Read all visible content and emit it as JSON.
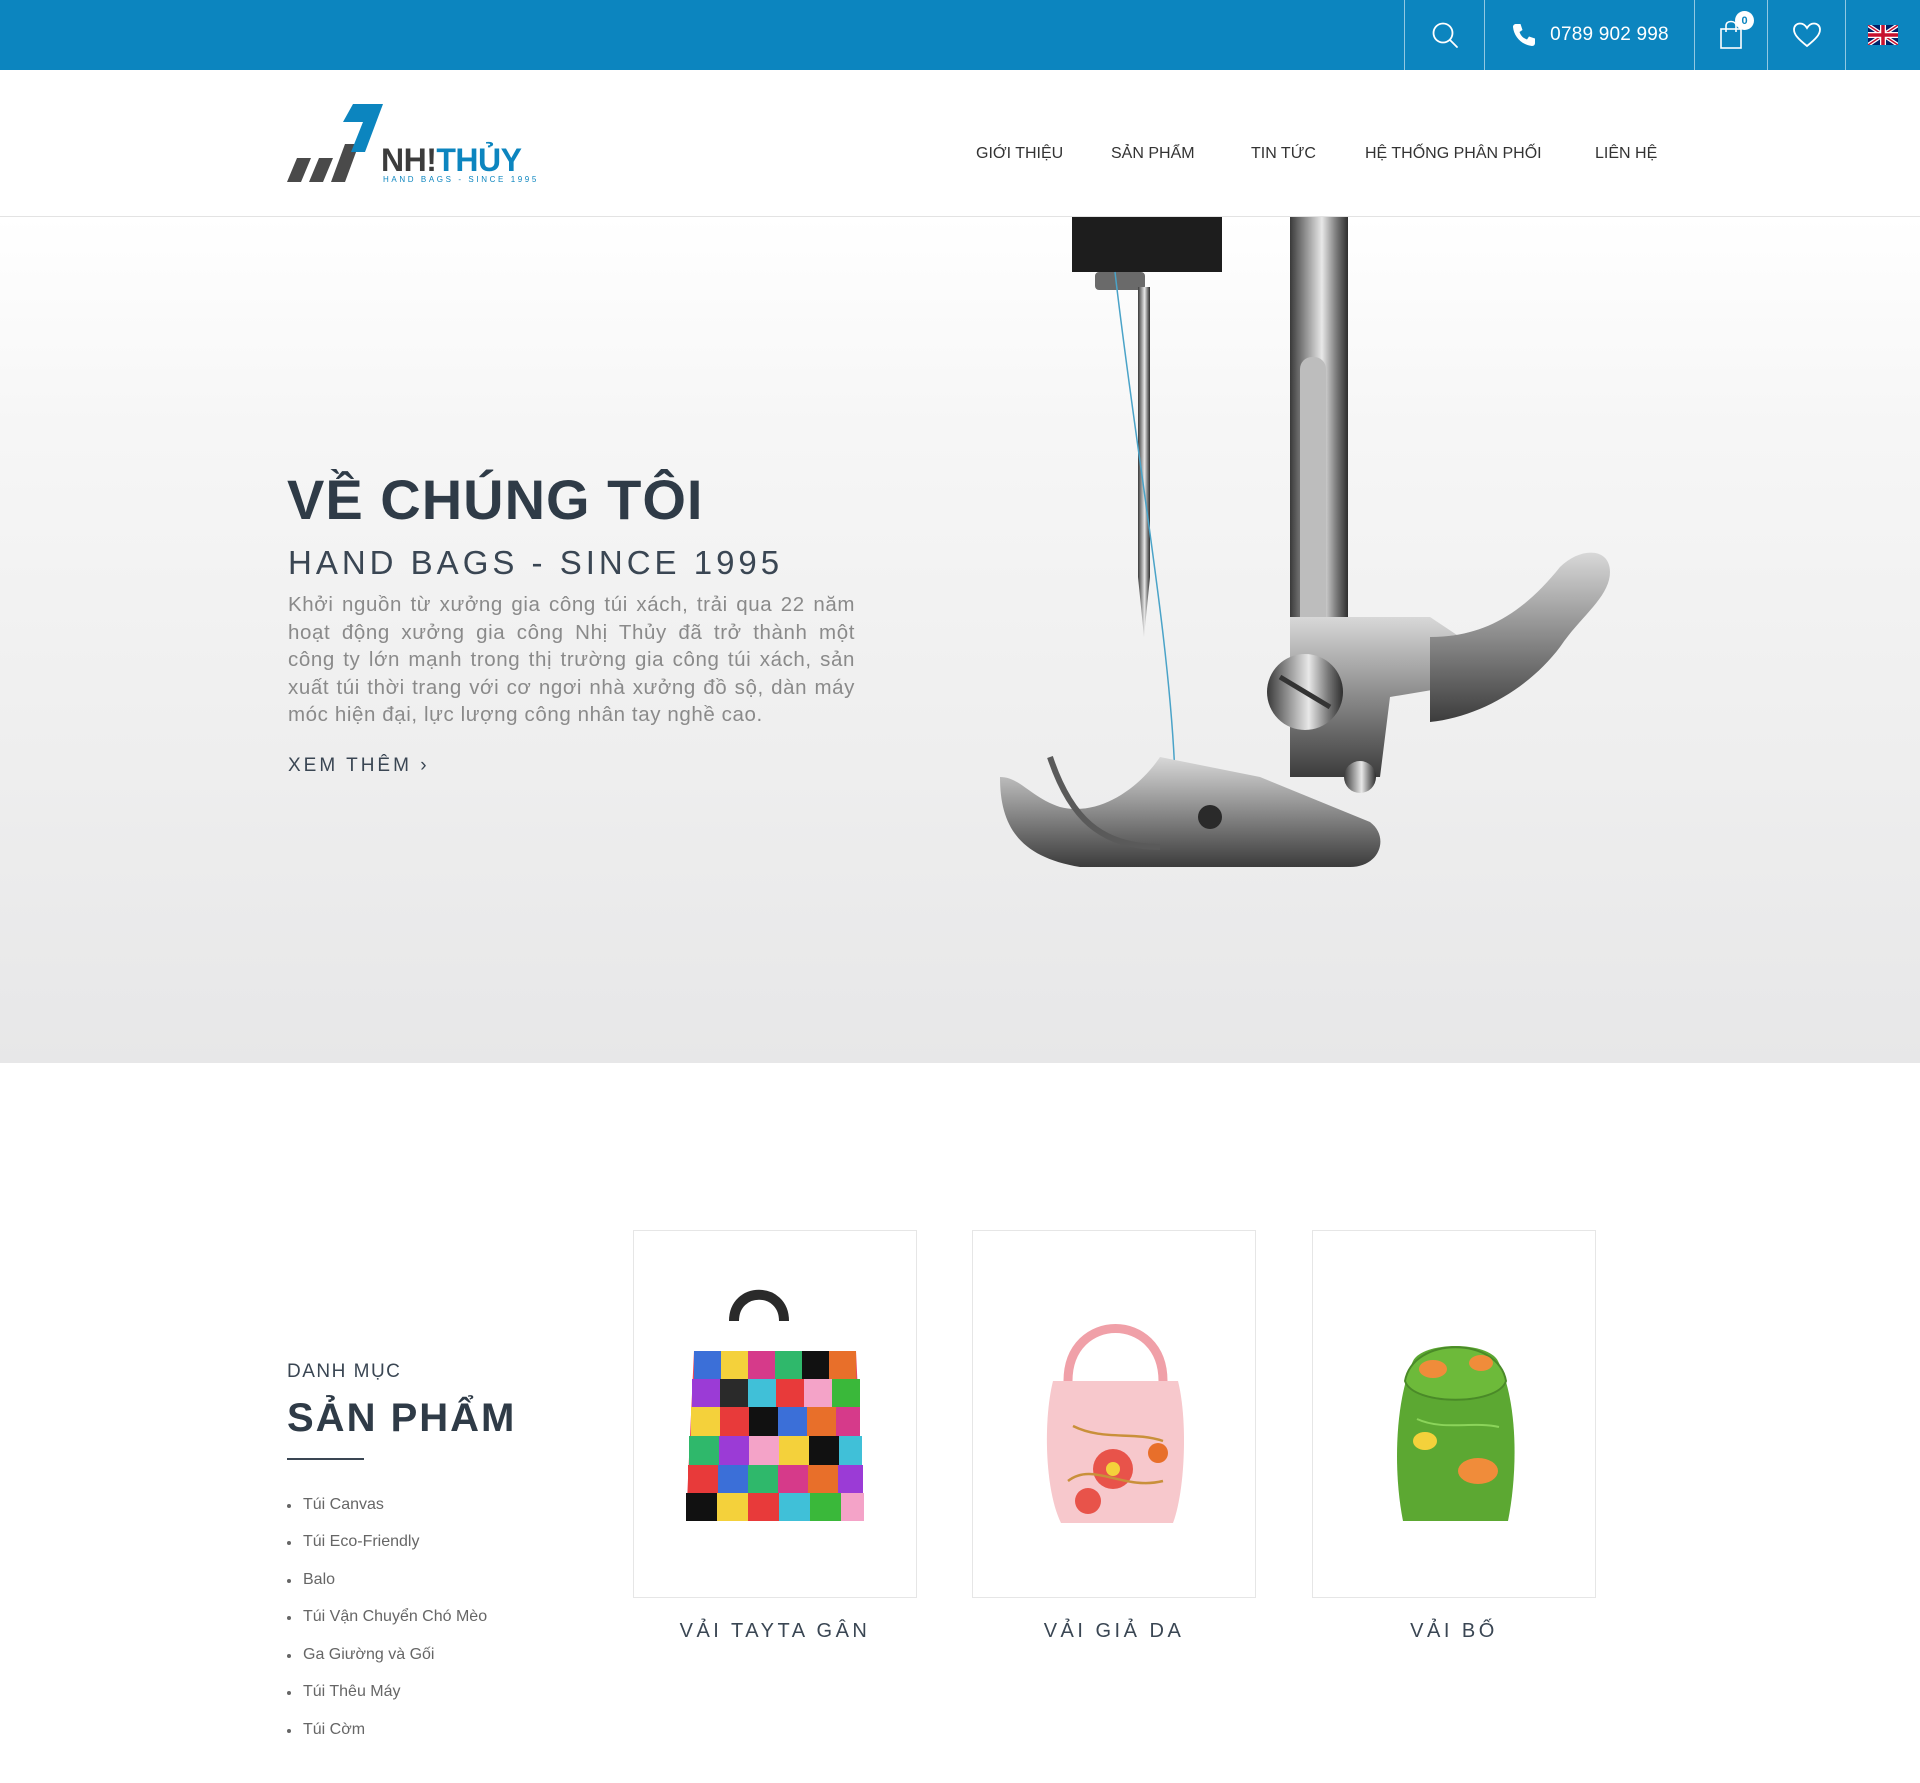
{
  "topbar": {
    "phone": "0789 902 998",
    "cart_count": "0",
    "icons": [
      "search-icon",
      "phone-icon",
      "cart-icon",
      "heart-icon",
      "uk-flag-icon"
    ],
    "color": "#0c85bf"
  },
  "header": {
    "logo_primary": "NH!",
    "logo_secondary": "THỦY",
    "logo_tagline": "HAND BAGS - SINCE 1995",
    "nav": [
      {
        "label": "GIỚI THIỆU"
      },
      {
        "label": "SẢN PHẨM"
      },
      {
        "label": "TIN TỨC"
      },
      {
        "label": "HỆ THỐNG PHÂN PHỐI"
      },
      {
        "label": "LIÊN HỆ"
      }
    ]
  },
  "hero": {
    "title": "VỀ CHÚNG TÔI",
    "subtitle": "HAND BAGS - SINCE 1995",
    "description": "Khởi nguồn từ xưởng gia công túi xách, trải qua 22 năm hoạt động xưởng gia công Nhị Thủy đã trở thành một công ty lớn mạnh trong thị trường gia công túi xách, sản xuất túi thời trang với cơ ngơi nhà xưởng đồ sộ, dàn máy móc hiện đại, lực lượng công nhân tay nghề cao.",
    "more_label": "XEM THÊM ›"
  },
  "categories": {
    "label": "DANH MỤC",
    "title": "SẢN PHẨM",
    "items": [
      {
        "label": "Túi Canvas"
      },
      {
        "label": "Túi Eco-Friendly"
      },
      {
        "label": "Balo"
      },
      {
        "label": "Túi Vận Chuyển Chó Mèo"
      },
      {
        "label": "Ga Giường và Gối"
      },
      {
        "label": "Túi Thêu Máy"
      },
      {
        "label": "Túi Cờm"
      }
    ]
  },
  "products": [
    {
      "name": "VẢI TAYTA GÂN"
    },
    {
      "name": "VẢI GIẢ DA"
    },
    {
      "name": "VẢI BỐ"
    }
  ]
}
